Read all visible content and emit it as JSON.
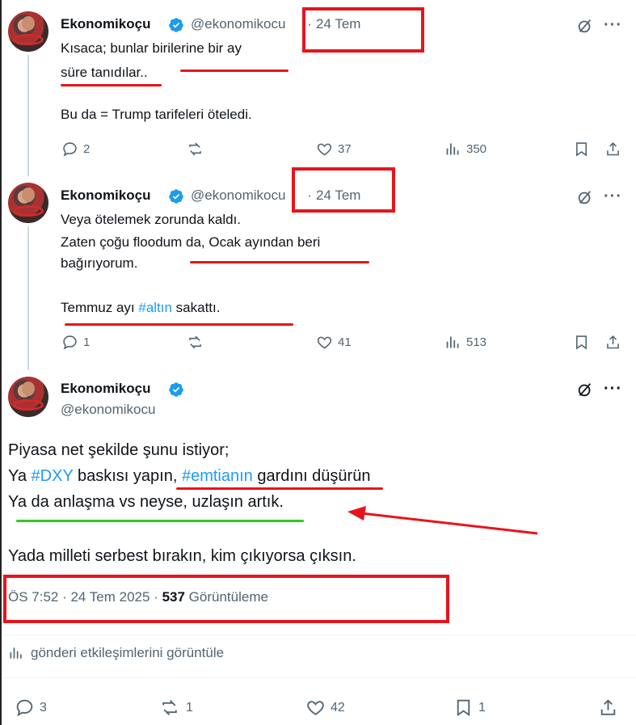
{
  "author": {
    "name": "Ekonomikoçu",
    "handle": "@ekonomikocu",
    "handle_truncated": "@ekonomikocu"
  },
  "tweets": [
    {
      "date": "24 Tem",
      "lines": [
        "Kısaca; bunlar birilerine bir ay",
        "süre tanıdılar..",
        "",
        "Bu da = Trump tarifeleri öteledi."
      ],
      "replies": "2",
      "retweets": "",
      "likes": "37",
      "views": "350"
    },
    {
      "date": "24 Tem",
      "lines": [
        "Veya ötelemek zorunda kaldı.",
        "Zaten çoğu floodum da, Ocak ayından beri",
        "bağırıyorum."
      ],
      "line4_pre": "Temmuz ayı ",
      "line4_tag": "#altın",
      "line4_post": " sakattı.",
      "replies": "1",
      "retweets": "",
      "likes": "41",
      "views": "513"
    }
  ],
  "main": {
    "line1": "Piyasa net şekilde şunu istiyor;",
    "line2_a": "Ya ",
    "line2_tag1": "#DXY",
    "line2_b": " baskısı yapın, ",
    "line2_tag2": "#emtianın",
    "line2_c": " gardını düşürün",
    "line3": "Ya da anlaşma vs neyse, uzlaşın artık.",
    "line4": "Yada milleti serbest bırakın, kim çıkıyorsa çıksın.",
    "timestamp": "ÖS 7:52 · 24 Tem 2025 · ",
    "views_count": "537",
    "views_label": " Görüntüleme",
    "engagements_link": "gönderi etkileşimlerini görüntüle",
    "replies": "3",
    "retweets": "1",
    "likes": "42",
    "bookmarks": "1"
  },
  "icons": [
    "reply-icon",
    "retweet-icon",
    "like-icon",
    "views-icon",
    "bookmark-icon",
    "share-icon",
    "grok-icon",
    "more-icon",
    "verified-icon"
  ],
  "colors": {
    "accent": "#1d9bf0",
    "annotation_red": "#e8141b",
    "annotation_green": "#2ecc1f",
    "muted": "#536471"
  }
}
